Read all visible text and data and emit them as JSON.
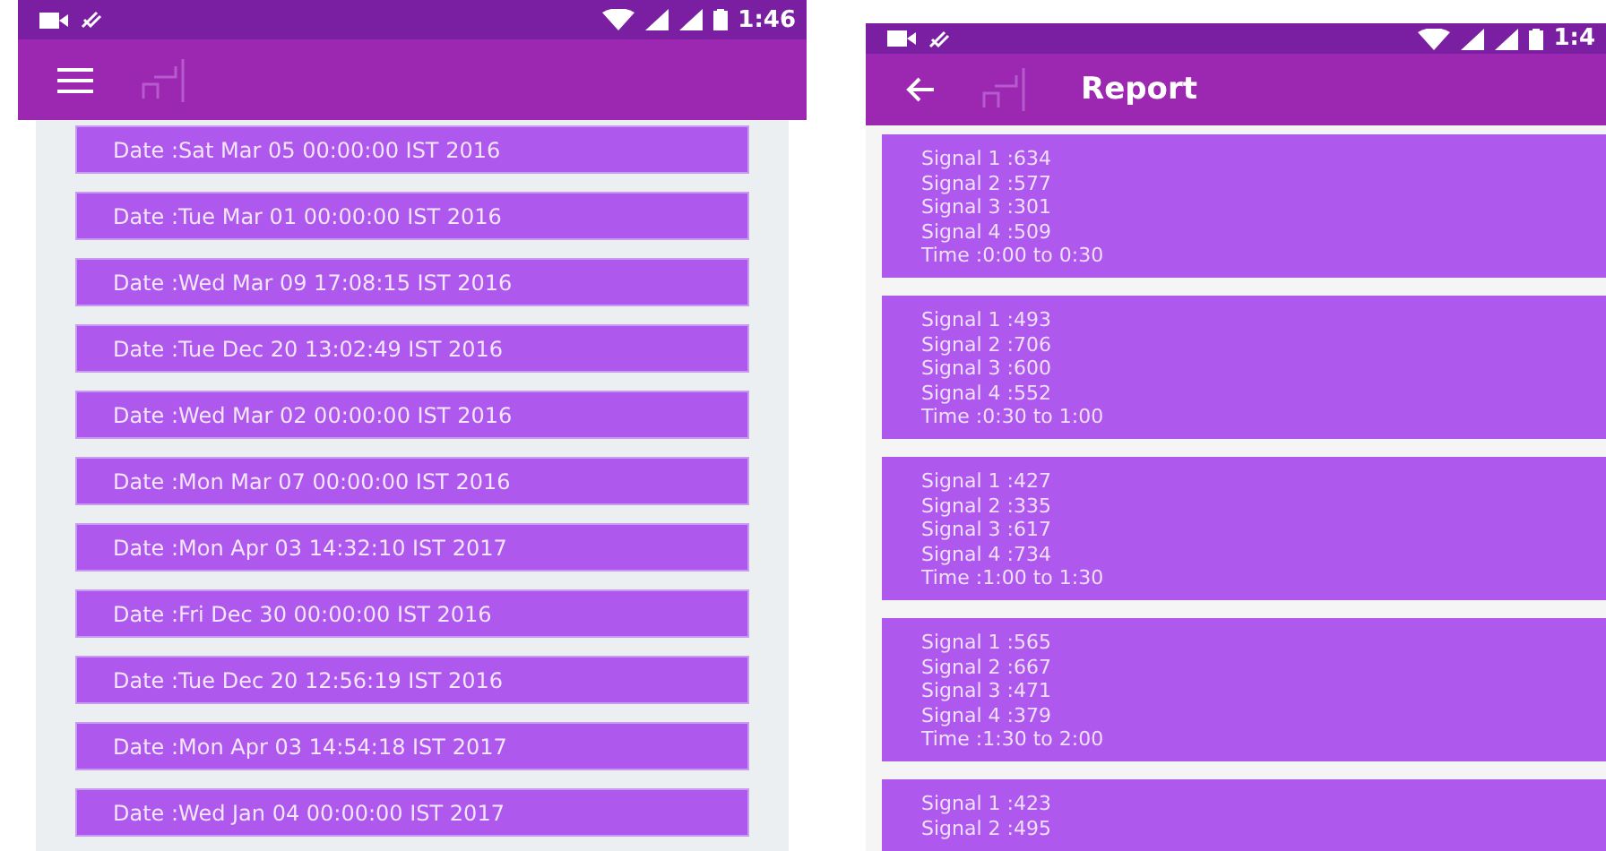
{
  "screens": [
    {
      "status_bar": {
        "time": "1:46"
      },
      "toolbar": {
        "nav_icon": {
          "kind": "menu"
        }
      },
      "dates": [
        "Date :Sat Mar 05 00:00:00 IST 2016",
        "Date :Tue Mar 01 00:00:00 IST 2016",
        "Date :Wed Mar 09 17:08:15 IST 2016",
        "Date :Tue Dec 20 13:02:49 IST 2016",
        "Date :Wed Mar 02 00:00:00 IST 2016",
        "Date :Mon Mar 07 00:00:00 IST 2016",
        "Date :Mon Apr 03 14:32:10 IST 2017",
        "Date :Fri Dec 30 00:00:00 IST 2016",
        "Date :Tue Dec 20 12:56:19 IST 2016",
        "Date :Mon Apr 03 14:54:18 IST 2017",
        "Date :Wed Jan 04 00:00:00 IST 2017"
      ]
    },
    {
      "status_bar": {
        "time": "1:4"
      },
      "toolbar": {
        "nav_icon": {
          "kind": "back"
        },
        "title": "Report"
      },
      "reports": [
        {
          "lines": [
            "Signal 1 :634",
            "Signal 2 :577",
            "Signal 3 :301",
            "Signal 4 :509",
            "Time :0:00 to 0:30"
          ]
        },
        {
          "lines": [
            "Signal 1 :493",
            "Signal 2 :706",
            "Signal 3 :600",
            "Signal 4 :552",
            "Time :0:30 to 1:00"
          ]
        },
        {
          "lines": [
            "Signal 1 :427",
            "Signal 2 :335",
            "Signal 3 :617",
            "Signal 4 :734",
            "Time :1:00 to 1:30"
          ]
        },
        {
          "lines": [
            "Signal 1 :565",
            "Signal 2 :667",
            "Signal 3 :471",
            "Signal 4 :379",
            "Time :1:30 to 2:00"
          ]
        },
        {
          "lines": [
            "Signal 1 :423",
            "Signal 2 :495"
          ]
        }
      ]
    }
  ]
}
